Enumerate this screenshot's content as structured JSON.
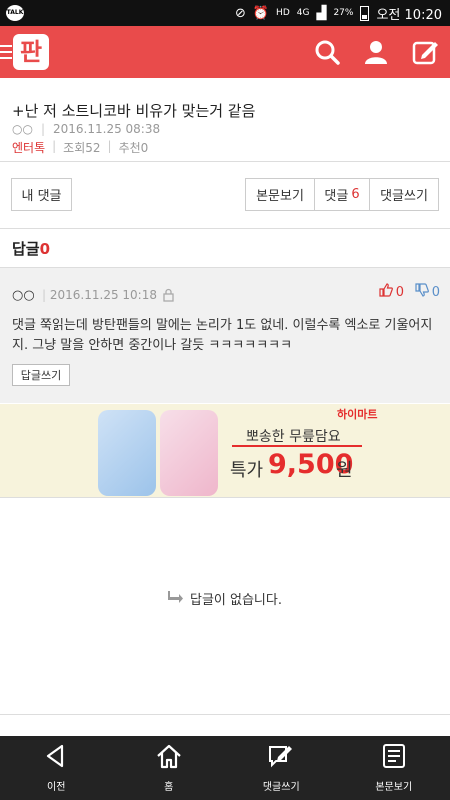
{
  "status_bar": {
    "talk_label": "TALK",
    "network": "HD",
    "signal": "4G",
    "battery": "27%",
    "time": "오전 10:20"
  },
  "app_header": {
    "logo_text": "판"
  },
  "post": {
    "title": "+난 저 소트니코바 비유가 맞는거 같음",
    "author": "○○",
    "date": "2016.11.25 08:38",
    "category": "엔터톡",
    "views": "조회52",
    "recommends": "추천0"
  },
  "actions": {
    "my_comments": "내 댓글",
    "view_post": "본문보기",
    "comments_label": "댓글",
    "comments_count": "6",
    "write_comment": "댓글쓰기"
  },
  "replies": {
    "label": "답글",
    "count": "0"
  },
  "comment": {
    "author": "○○",
    "date": "2016.11.25 10:18",
    "likes": "0",
    "dislikes": "0",
    "text": "댓글 쭉읽는데 방탄팬들의 말에는 논리가 1도 없네. 이럴수록 엑소로 기울어지지. 그냥 말을 안하면 중간이나 갈듯 ㅋㅋㅋㅋㅋㅋㅋ",
    "reply_button": "답글쓰기"
  },
  "ad": {
    "brand": "하이마트",
    "slogan": "뽀송한 무릎담요",
    "price_label": "특가",
    "price": "9,500",
    "currency": "원"
  },
  "empty_state": {
    "message": "답글이 없습니다."
  },
  "bottom_nav": {
    "items": [
      {
        "label": "이전",
        "icon": "back-icon"
      },
      {
        "label": "홈",
        "icon": "home-icon"
      },
      {
        "label": "댓글쓰기",
        "icon": "write-comment-icon"
      },
      {
        "label": "본문보기",
        "icon": "document-icon"
      }
    ]
  },
  "colors": {
    "brand": "#e94b4b",
    "accent_red": "#d33333",
    "nav_bg": "#232323"
  }
}
